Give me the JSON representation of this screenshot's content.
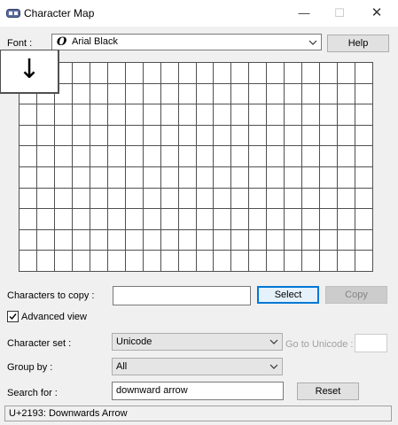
{
  "window": {
    "title": "Character Map",
    "minimize_glyph": "—",
    "maximize_glyph": "☐",
    "close_glyph": "✕"
  },
  "font": {
    "label": "Font :",
    "icon_glyph": "O",
    "value": "Arial Black",
    "help_label": "Help"
  },
  "char_grid": {
    "columns": 20,
    "rows": 10,
    "selected_char": "↓"
  },
  "copy": {
    "label": "Characters to copy :",
    "value": "",
    "select_label": "Select",
    "copy_label": "Copy"
  },
  "advanced_view": {
    "label": "Advanced view",
    "checked": true
  },
  "character_set": {
    "label": "Character set :",
    "value": "Unicode",
    "goto_label": "Go to Unicode :",
    "goto_value": ""
  },
  "group_by": {
    "label": "Group by :",
    "value": "All"
  },
  "search": {
    "label": "Search for :",
    "value": "downward arrow",
    "reset_label": "Reset"
  },
  "status": {
    "text": "U+2193: Downwards Arrow"
  }
}
